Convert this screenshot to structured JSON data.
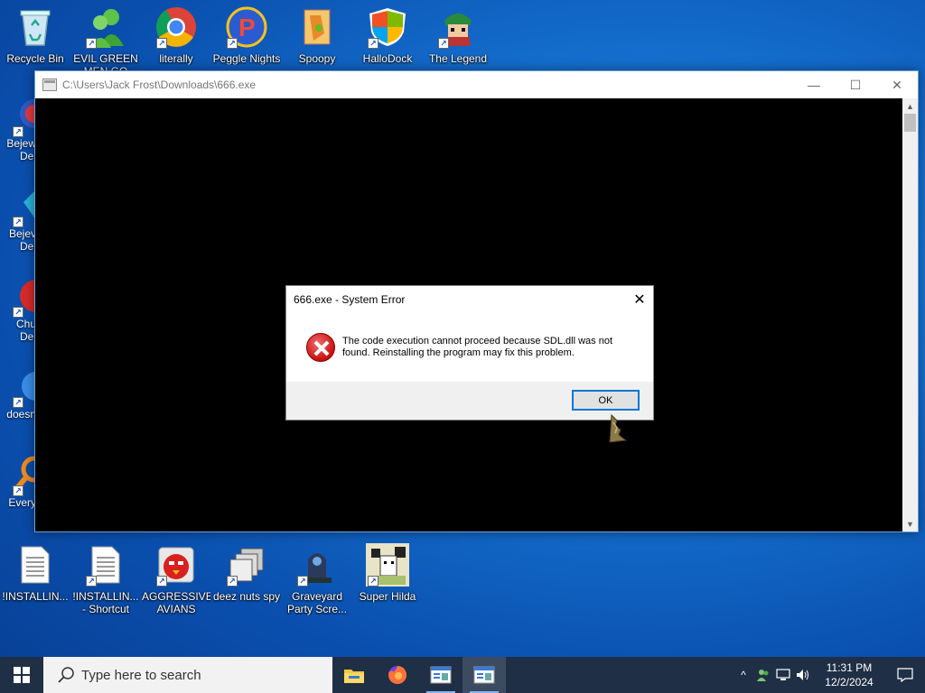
{
  "desktop": {
    "top_icons": [
      {
        "label": "Recycle Bin",
        "icon": "recycle-bin-icon"
      },
      {
        "label": "EVIL GREEN MEN GO",
        "icon": "green-men-icon"
      },
      {
        "label": "literally",
        "icon": "chrome-icon"
      },
      {
        "label": "Peggle Nights",
        "icon": "peggle-icon"
      },
      {
        "label": "Spoopy",
        "icon": "spoopy-icon"
      },
      {
        "label": "HalloDock",
        "icon": "windows-shield-icon"
      },
      {
        "label": "The Legend",
        "icon": "legend-character-icon"
      }
    ],
    "left_icons": [
      {
        "label": "Bejew",
        "label2": "Del",
        "icon": "bejeweled-icon"
      },
      {
        "label": "Bejev",
        "label2": "Del",
        "icon": "bejeweled-diamond-icon"
      },
      {
        "label": "Chu",
        "label2": "Del",
        "icon": "chuzzle-icon"
      },
      {
        "label": "doesn",
        "label2": "",
        "icon": "blue-app-icon"
      },
      {
        "label": "Every",
        "label2": "",
        "icon": "everything-search-icon"
      }
    ],
    "bottom_icons": [
      {
        "label": "!INSTALLIN...",
        "icon": "text-file-icon"
      },
      {
        "label": "!INSTALLIN... - Shortcut",
        "icon": "text-file-shortcut-icon"
      },
      {
        "label": "AGGRESSIVE AVIANS",
        "icon": "angry-bird-icon"
      },
      {
        "label": "deez nuts spy",
        "icon": "stack-windows-icon"
      },
      {
        "label": "Graveyard Party Scre...",
        "icon": "graveyard-icon"
      },
      {
        "label": "Super Hilda",
        "icon": "hilda-icon"
      }
    ]
  },
  "console": {
    "title": "C:\\Users\\Jack Frost\\Downloads\\666.exe",
    "minimize": "—",
    "maximize": "☐",
    "close": "✕"
  },
  "dialog": {
    "title": "666.exe - System Error",
    "message": "The code execution cannot proceed because SDL.dll was not found. Reinstalling the program may fix this problem.",
    "ok_label": "OK",
    "close": "✕"
  },
  "taskbar": {
    "search_placeholder": "Type here to search",
    "apps": [
      "file-explorer-icon",
      "firefox-icon",
      "console-app-icon",
      "console-app-icon"
    ],
    "time": "11:31 PM",
    "date": "12/2/2024"
  },
  "colors": {
    "taskbar": "#1f2f45",
    "accent": "#0078d7",
    "desktop": "#1570cf"
  }
}
